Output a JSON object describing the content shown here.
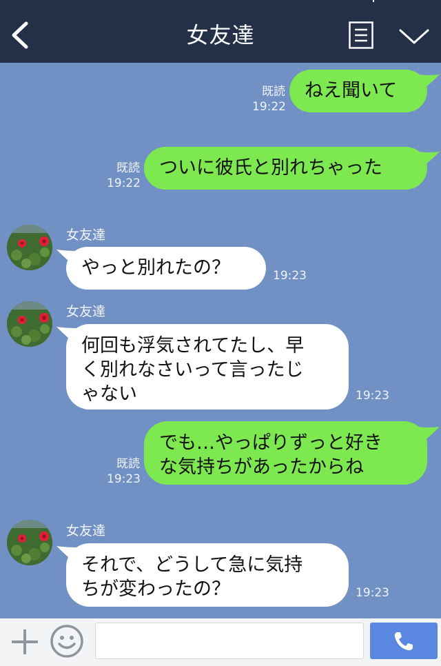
{
  "header": {
    "title": "女友達"
  },
  "colors": {
    "header_bg": "#233048",
    "chat_bg": "#7190c3",
    "outgoing_bubble": "#7de84f",
    "incoming_bubble": "#ffffff",
    "send_button": "#5a87e0"
  },
  "icons": {
    "back": "chevron-left-icon",
    "menu": "list-menu-icon",
    "more": "chevron-down-icon",
    "add": "plus-icon",
    "sticker": "smiley-icon",
    "call": "phone-icon"
  },
  "messages": [
    {
      "from": "me",
      "text": "ねえ聞いて",
      "read": "既読",
      "time": "19:22"
    },
    {
      "from": "me",
      "text": "ついに彼氏と別れちゃった",
      "read": "既読",
      "time": "19:22"
    },
    {
      "from": "friend",
      "sender": "女友達",
      "text": "やっと別れたの？",
      "time": "19:23"
    },
    {
      "from": "friend",
      "sender": "女友達",
      "text_lines": [
        "何回も浮気されてたし、早",
        "く別れなさいって言ったじ",
        "ゃない"
      ],
      "time": "19:23"
    },
    {
      "from": "me",
      "text_lines": [
        "でも…やっぱりずっと好き",
        "な気持ちがあったからね"
      ],
      "read": "既読",
      "time": "19:23"
    },
    {
      "from": "friend",
      "sender": "女友達",
      "text_lines": [
        "それで、どうして急に気持",
        "ちが変わったの？"
      ],
      "time": "19:23"
    }
  ],
  "composer": {
    "placeholder": ""
  }
}
